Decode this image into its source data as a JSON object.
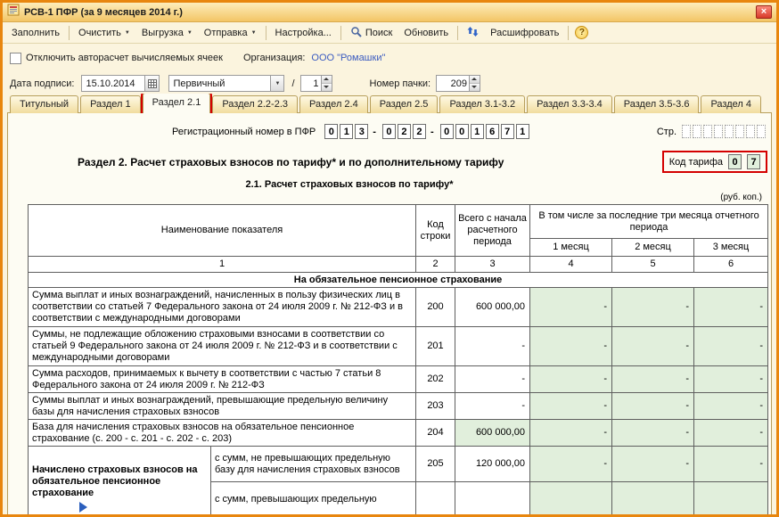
{
  "window": {
    "title": "РСВ-1 ПФР (за 9 месяцев 2014 г.)"
  },
  "icons": {
    "dropdown": "▼",
    "close": "×",
    "help": "?"
  },
  "toolbar": {
    "fill": "Заполнить",
    "clear": "Очистить",
    "upload": "Выгрузка",
    "send": "Отправка",
    "settings": "Настройка...",
    "search": "Поиск",
    "refresh": "Обновить",
    "decrypt": "Расшифровать"
  },
  "header": {
    "autocalc_label": "Отключить авторасчет вычисляемых ячеек",
    "org_label": "Организация:",
    "org_value": "ООО \"Ромашки\"",
    "date_label": "Дата подписи:",
    "date_value": "15.10.2014",
    "type_value": "Первичный",
    "slash": "/",
    "correction_value": "1",
    "pack_label": "Номер пачки:",
    "pack_value": "209"
  },
  "tabs": {
    "items": [
      "Титульный",
      "Раздел 1",
      "Раздел 2.1",
      "Раздел 2.2-2.3",
      "Раздел 2.4",
      "Раздел 2.5",
      "Раздел 3.1-3.2",
      "Раздел 3.3-3.4",
      "Раздел 3.5-3.6",
      "Раздел 4"
    ],
    "active": "Раздел 2.1"
  },
  "content": {
    "reg_label": "Регистрационный номер в ПФР",
    "reg_digits": [
      "0",
      "1",
      "3",
      "0",
      "2",
      "2",
      "0",
      "0",
      "1",
      "6",
      "7",
      "1"
    ],
    "dash": "-",
    "page_label": "Стр.",
    "section_title": "Раздел 2. Расчет страховых взносов по тарифу* и по дополнительному тарифу",
    "tariff_label": "Код тарифа",
    "tariff_digits": [
      "0",
      "7"
    ],
    "subsection_title": "2.1. Расчет страховых взносов по тарифу*",
    "currency_note": "(руб. коп.)"
  },
  "table": {
    "header": {
      "name": "Наименование показателя",
      "code": "Код строки",
      "total": "Всего с начала расчетного периода",
      "months_group": "В том числе за последние три месяца отчетного периода",
      "m1": "1 месяц",
      "m2": "2 месяц",
      "m3": "3 месяц"
    },
    "col_numbers": [
      "1",
      "2",
      "3",
      "4",
      "5",
      "6"
    ],
    "section_row": "На обязательное пенсионное страхование",
    "rows": [
      {
        "name": "Сумма выплат и иных вознаграждений, начисленных в пользу физических лиц в соответствии со статьей 7 Федерального закона от 24 июля 2009 г. № 212-ФЗ и в соответствии с международными договорами",
        "code": "200",
        "total": "600 000,00",
        "m1": "-",
        "m2": "-",
        "m3": "-"
      },
      {
        "name": "Суммы, не подлежащие обложению страховыми взносами в соответствии со статьей 9 Федерального закона от 24 июля 2009 г. № 212-ФЗ и в соответствии с международными договорами",
        "code": "201",
        "total": "-",
        "m1": "-",
        "m2": "-",
        "m3": "-"
      },
      {
        "name": "Сумма расходов, принимаемых к вычету в соответствии с частью 7 статьи 8 Федерального закона от 24 июля 2009 г. № 212-ФЗ",
        "code": "202",
        "total": "-",
        "m1": "-",
        "m2": "-",
        "m3": "-"
      },
      {
        "name": "Суммы выплат и иных вознаграждений, превышающие предельную величину базы для начисления страховых взносов",
        "code": "203",
        "total": "-",
        "m1": "-",
        "m2": "-",
        "m3": "-"
      },
      {
        "name": "База для начисления страховых взносов на обязательное пенсионное страхование (с. 200 - с. 201 - с. 202 - с. 203)",
        "code": "204",
        "total": "600 000,00",
        "m1": "-",
        "m2": "-",
        "m3": "-"
      }
    ],
    "group_row": {
      "group_label": "Начислено страховых взносов на обязательное пенсионное страхование",
      "sub1": {
        "name": "с сумм, не превышающих предельную базу для начисления страховых взносов",
        "code": "205",
        "total": "120 000,00",
        "m1": "-",
        "m2": "-",
        "m3": "-"
      },
      "sub2": {
        "name": "с сумм, превышающих предельную"
      }
    }
  }
}
